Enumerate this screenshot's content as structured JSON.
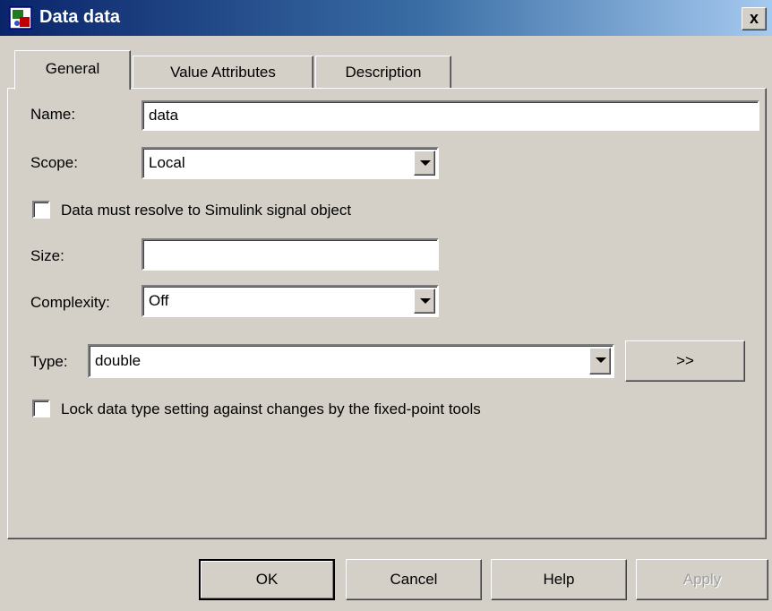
{
  "window": {
    "title": "Data data",
    "close_label": "x"
  },
  "tabs": [
    {
      "label": "General",
      "active": true
    },
    {
      "label": "Value Attributes",
      "active": false
    },
    {
      "label": "Description",
      "active": false
    }
  ],
  "general": {
    "name_label": "Name:",
    "name_value": "data",
    "scope_label": "Scope:",
    "scope_value": "Local",
    "resolve_checkbox_label": "Data must resolve to Simulink signal object",
    "resolve_checked": false,
    "size_label": "Size:",
    "size_value": "",
    "complexity_label": "Complexity:",
    "complexity_value": "Off",
    "type_label": "Type:",
    "type_value": "double",
    "type_assistant_label": ">>",
    "lock_checkbox_label": "Lock data type setting against changes by the fixed-point tools",
    "lock_checked": false
  },
  "buttons": {
    "ok": "OK",
    "cancel": "Cancel",
    "help": "Help",
    "apply": "Apply"
  }
}
